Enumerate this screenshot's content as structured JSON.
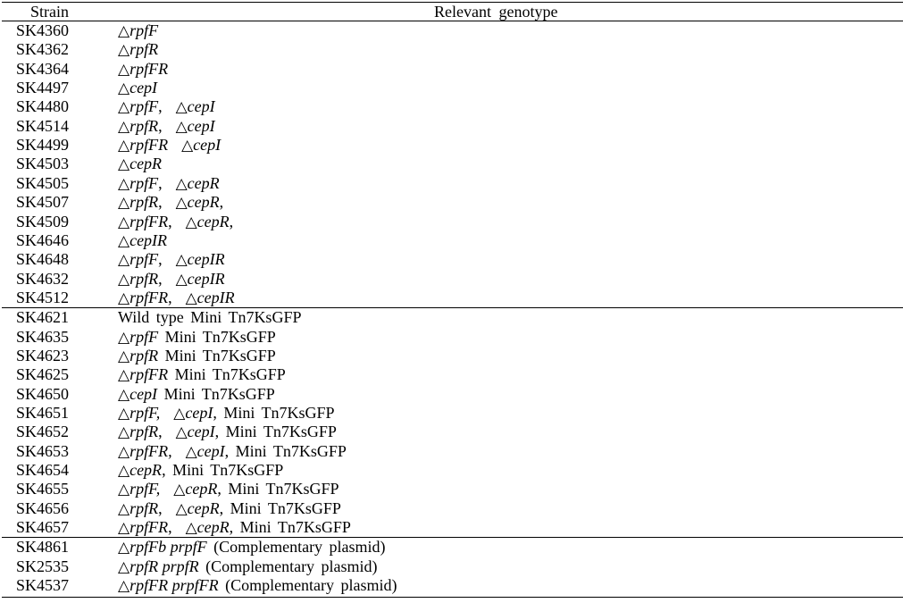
{
  "table": {
    "headers": {
      "strain": "Strain",
      "genotype": "Relevant  genotype"
    },
    "groups": [
      {
        "rows": [
          {
            "strain": "SK4360",
            "genotype": [
              {
                "t": "tri"
              },
              {
                "t": "i",
                "v": "rpfF"
              }
            ]
          },
          {
            "strain": "SK4362",
            "genotype": [
              {
                "t": "tri"
              },
              {
                "t": "i",
                "v": "rpfR"
              }
            ]
          },
          {
            "strain": "SK4364",
            "genotype": [
              {
                "t": "tri"
              },
              {
                "t": "i",
                "v": "rpfFR"
              }
            ]
          },
          {
            "strain": "SK4497",
            "genotype": [
              {
                "t": "tri"
              },
              {
                "t": "i",
                "v": "cepI"
              }
            ]
          },
          {
            "strain": "SK4480",
            "genotype": [
              {
                "t": "tri"
              },
              {
                "t": "i",
                "v": "rpfF"
              },
              {
                "t": "p",
                "v": ",  "
              },
              {
                "t": "tri"
              },
              {
                "t": "i",
                "v": "cepI"
              }
            ]
          },
          {
            "strain": "SK4514",
            "genotype": [
              {
                "t": "tri"
              },
              {
                "t": "i",
                "v": "rpfR"
              },
              {
                "t": "p",
                "v": ",  "
              },
              {
                "t": "tri"
              },
              {
                "t": "i",
                "v": "cepI"
              }
            ]
          },
          {
            "strain": "SK4499",
            "genotype": [
              {
                "t": "tri"
              },
              {
                "t": "i",
                "v": "rpfFR"
              },
              {
                "t": "p",
                "v": "  "
              },
              {
                "t": "tri"
              },
              {
                "t": "i",
                "v": "cepI"
              }
            ]
          },
          {
            "strain": "SK4503",
            "genotype": [
              {
                "t": "tri"
              },
              {
                "t": "i",
                "v": "cepR"
              }
            ]
          },
          {
            "strain": "SK4505",
            "genotype": [
              {
                "t": "tri"
              },
              {
                "t": "i",
                "v": "rpfF"
              },
              {
                "t": "p",
                "v": ",  "
              },
              {
                "t": "tri"
              },
              {
                "t": "i",
                "v": "cepR"
              }
            ]
          },
          {
            "strain": "SK4507",
            "genotype": [
              {
                "t": "tri"
              },
              {
                "t": "i",
                "v": "rpfR"
              },
              {
                "t": "p",
                "v": ",  "
              },
              {
                "t": "tri"
              },
              {
                "t": "i",
                "v": "cepR"
              },
              {
                "t": "p",
                "v": ","
              }
            ]
          },
          {
            "strain": "SK4509",
            "genotype": [
              {
                "t": "tri"
              },
              {
                "t": "i",
                "v": "rpfFR"
              },
              {
                "t": "p",
                "v": ",  "
              },
              {
                "t": "tri"
              },
              {
                "t": "i",
                "v": "cepR"
              },
              {
                "t": "p",
                "v": ","
              }
            ]
          },
          {
            "strain": "SK4646",
            "genotype": [
              {
                "t": "tri"
              },
              {
                "t": "i",
                "v": "cepIR"
              }
            ]
          },
          {
            "strain": "SK4648",
            "genotype": [
              {
                "t": "tri"
              },
              {
                "t": "i",
                "v": "rpfF"
              },
              {
                "t": "p",
                "v": ",  "
              },
              {
                "t": "tri"
              },
              {
                "t": "i",
                "v": "cepIR"
              }
            ]
          },
          {
            "strain": "SK4632",
            "genotype": [
              {
                "t": "tri"
              },
              {
                "t": "i",
                "v": "rpfR"
              },
              {
                "t": "p",
                "v": ",  "
              },
              {
                "t": "tri"
              },
              {
                "t": "i",
                "v": "cepIR"
              }
            ]
          },
          {
            "strain": "SK4512",
            "genotype": [
              {
                "t": "tri"
              },
              {
                "t": "i",
                "v": "rpfFR"
              },
              {
                "t": "p",
                "v": ",  "
              },
              {
                "t": "tri"
              },
              {
                "t": "i",
                "v": "cepIR"
              }
            ]
          }
        ]
      },
      {
        "rows": [
          {
            "strain": "SK4621",
            "genotype": [
              {
                "t": "p",
                "v": "Wild type Mini Tn7KsGFP"
              }
            ]
          },
          {
            "strain": "SK4635",
            "genotype": [
              {
                "t": "tri"
              },
              {
                "t": "i",
                "v": "rpfF"
              },
              {
                "t": "p",
                "v": " Mini Tn7KsGFP"
              }
            ]
          },
          {
            "strain": "SK4623",
            "genotype": [
              {
                "t": "tri"
              },
              {
                "t": "i",
                "v": "rpfR"
              },
              {
                "t": "p",
                "v": " Mini Tn7KsGFP"
              }
            ]
          },
          {
            "strain": "SK4625",
            "genotype": [
              {
                "t": "tri"
              },
              {
                "t": "i",
                "v": "rpfFR"
              },
              {
                "t": "p",
                "v": " Mini Tn7KsGFP"
              }
            ]
          },
          {
            "strain": "SK4650",
            "genotype": [
              {
                "t": "tri"
              },
              {
                "t": "i",
                "v": "cepI"
              },
              {
                "t": "p",
                "v": " Mini Tn7KsGFP"
              }
            ]
          },
          {
            "strain": "SK4651",
            "genotype": [
              {
                "t": "tri"
              },
              {
                "t": "i",
                "v": "rpfF,"
              },
              {
                "t": "p",
                "v": "  "
              },
              {
                "t": "tri"
              },
              {
                "t": "i",
                "v": "cepI"
              },
              {
                "t": "p",
                "v": ", Mini Tn7KsGFP"
              }
            ]
          },
          {
            "strain": "SK4652",
            "genotype": [
              {
                "t": "tri"
              },
              {
                "t": "i",
                "v": "rpfR"
              },
              {
                "t": "p",
                "v": ",  "
              },
              {
                "t": "tri"
              },
              {
                "t": "i",
                "v": "cepI"
              },
              {
                "t": "p",
                "v": ", Mini Tn7KsGFP"
              }
            ]
          },
          {
            "strain": "SK4653",
            "genotype": [
              {
                "t": "tri"
              },
              {
                "t": "i",
                "v": "rpfFR,"
              },
              {
                "t": "p",
                "v": "  "
              },
              {
                "t": "tri"
              },
              {
                "t": "i",
                "v": "cepI"
              },
              {
                "t": "p",
                "v": ", Mini Tn7KsGFP"
              }
            ]
          },
          {
            "strain": "SK4654",
            "genotype": [
              {
                "t": "tri"
              },
              {
                "t": "i",
                "v": "cepR"
              },
              {
                "t": "p",
                "v": ", Mini Tn7KsGFP"
              }
            ]
          },
          {
            "strain": "SK4655",
            "genotype": [
              {
                "t": "tri"
              },
              {
                "t": "i",
                "v": "rpfF,"
              },
              {
                "t": "p",
                "v": "  "
              },
              {
                "t": "tri"
              },
              {
                "t": "i",
                "v": "cepR"
              },
              {
                "t": "p",
                "v": ", Mini Tn7KsGFP"
              }
            ]
          },
          {
            "strain": "SK4656",
            "genotype": [
              {
                "t": "tri"
              },
              {
                "t": "i",
                "v": "rpfR"
              },
              {
                "t": "p",
                "v": ",  "
              },
              {
                "t": "tri"
              },
              {
                "t": "i",
                "v": "cepR"
              },
              {
                "t": "p",
                "v": ", Mini Tn7KsGFP"
              }
            ]
          },
          {
            "strain": "SK4657",
            "genotype": [
              {
                "t": "tri"
              },
              {
                "t": "i",
                "v": "rpfFR"
              },
              {
                "t": "p",
                "v": ",  "
              },
              {
                "t": "tri"
              },
              {
                "t": "i",
                "v": "cepR"
              },
              {
                "t": "p",
                "v": ", Mini Tn7KsGFP"
              }
            ]
          }
        ]
      },
      {
        "rows": [
          {
            "strain": "SK4861",
            "genotype": [
              {
                "t": "tri"
              },
              {
                "t": "i",
                "v": "rpfFb prpfF"
              },
              {
                "t": "p",
                "v": " (Complementary plasmid)"
              }
            ]
          },
          {
            "strain": "SK2535",
            "genotype": [
              {
                "t": "tri"
              },
              {
                "t": "i",
                "v": "rpfR prpfR"
              },
              {
                "t": "p",
                "v": " (Complementary plasmid)"
              }
            ]
          },
          {
            "strain": "SK4537",
            "genotype": [
              {
                "t": "tri"
              },
              {
                "t": "i",
                "v": "rpfFR prpfFR"
              },
              {
                "t": "p",
                "v": " (Complementary plasmid)"
              }
            ]
          }
        ]
      }
    ],
    "delta_symbol": "△"
  }
}
